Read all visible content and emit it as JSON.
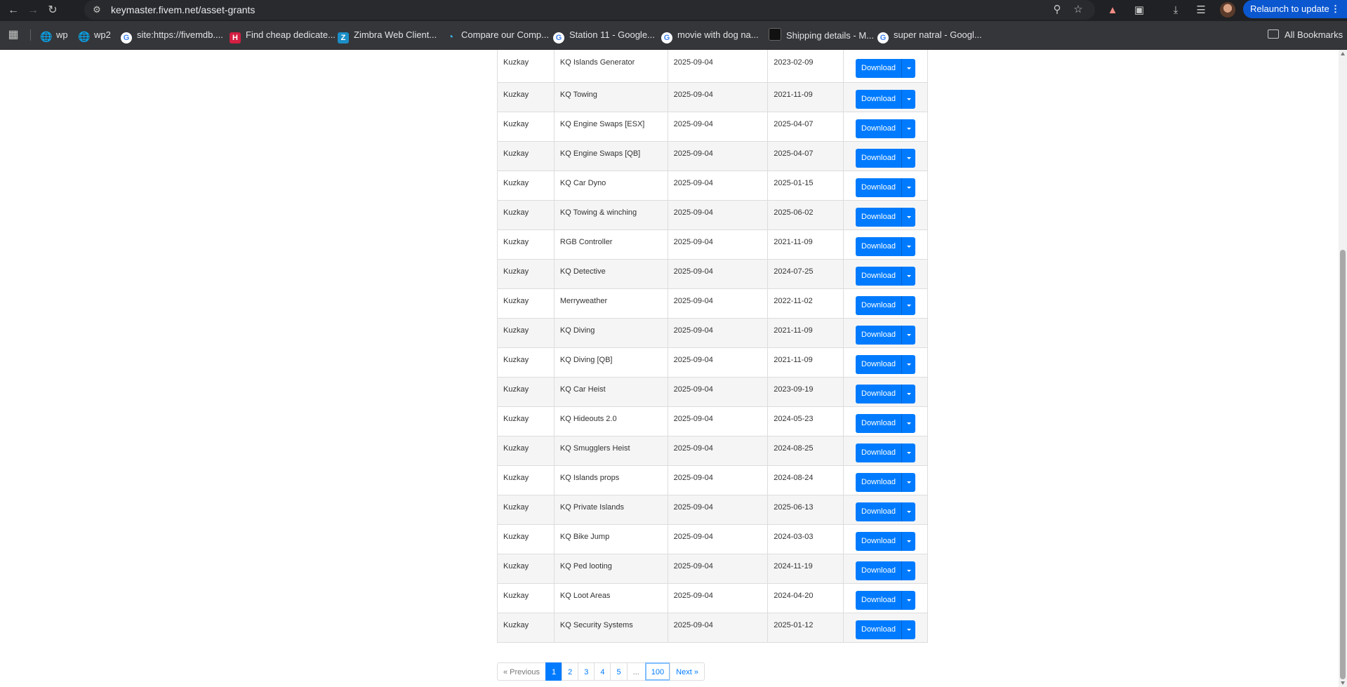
{
  "browser": {
    "url": "keymaster.fivem.net/asset-grants",
    "relaunch_label": "Relaunch to update",
    "bookmarks": [
      {
        "label": "wp",
        "icon": "globe-icon"
      },
      {
        "label": "wp2",
        "icon": "globe-icon"
      },
      {
        "label": "site:https://fivemdb....",
        "icon": "google-icon"
      },
      {
        "label": "Find cheap dedicate...",
        "icon": "hetzner-icon"
      },
      {
        "label": "Zimbra Web Client...",
        "icon": "zimbra-icon"
      },
      {
        "label": "Compare our Comp...",
        "icon": "compare-icon"
      },
      {
        "label": "Station 11 - Google...",
        "icon": "google-icon"
      },
      {
        "label": "movie with dog na...",
        "icon": "google-icon"
      },
      {
        "label": "Shipping details - M...",
        "icon": "shipping-icon"
      },
      {
        "label": "super natral - Googl...",
        "icon": "google-icon"
      }
    ],
    "all_bookmarks_label": "All Bookmarks"
  },
  "table": {
    "action_label": "Download",
    "rows": [
      {
        "owner": "Kuzkay",
        "name": "KQ Islands Generator",
        "granted": "2025-09-04",
        "created": "2023-02-09"
      },
      {
        "owner": "Kuzkay",
        "name": "KQ Towing",
        "granted": "2025-09-04",
        "created": "2021-11-09"
      },
      {
        "owner": "Kuzkay",
        "name": "KQ Engine Swaps [ESX]",
        "granted": "2025-09-04",
        "created": "2025-04-07"
      },
      {
        "owner": "Kuzkay",
        "name": "KQ Engine Swaps [QB]",
        "granted": "2025-09-04",
        "created": "2025-04-07"
      },
      {
        "owner": "Kuzkay",
        "name": "KQ Car Dyno",
        "granted": "2025-09-04",
        "created": "2025-01-15"
      },
      {
        "owner": "Kuzkay",
        "name": "KQ Towing & winching",
        "granted": "2025-09-04",
        "created": "2025-06-02"
      },
      {
        "owner": "Kuzkay",
        "name": "RGB Controller",
        "granted": "2025-09-04",
        "created": "2021-11-09"
      },
      {
        "owner": "Kuzkay",
        "name": "KQ Detective",
        "granted": "2025-09-04",
        "created": "2024-07-25"
      },
      {
        "owner": "Kuzkay",
        "name": "Merryweather",
        "granted": "2025-09-04",
        "created": "2022-11-02"
      },
      {
        "owner": "Kuzkay",
        "name": "KQ Diving",
        "granted": "2025-09-04",
        "created": "2021-11-09"
      },
      {
        "owner": "Kuzkay",
        "name": "KQ Diving [QB]",
        "granted": "2025-09-04",
        "created": "2021-11-09"
      },
      {
        "owner": "Kuzkay",
        "name": "KQ Car Heist",
        "granted": "2025-09-04",
        "created": "2023-09-19"
      },
      {
        "owner": "Kuzkay",
        "name": "KQ Hideouts 2.0",
        "granted": "2025-09-04",
        "created": "2024-05-23"
      },
      {
        "owner": "Kuzkay",
        "name": "KQ Smugglers Heist",
        "granted": "2025-09-04",
        "created": "2024-08-25"
      },
      {
        "owner": "Kuzkay",
        "name": "KQ Islands props",
        "granted": "2025-09-04",
        "created": "2024-08-24"
      },
      {
        "owner": "Kuzkay",
        "name": "KQ Private Islands",
        "granted": "2025-09-04",
        "created": "2025-06-13"
      },
      {
        "owner": "Kuzkay",
        "name": "KQ Bike Jump",
        "granted": "2025-09-04",
        "created": "2024-03-03"
      },
      {
        "owner": "Kuzkay",
        "name": "KQ Ped looting",
        "granted": "2025-09-04",
        "created": "2024-11-19"
      },
      {
        "owner": "Kuzkay",
        "name": "KQ Loot Areas",
        "granted": "2025-09-04",
        "created": "2024-04-20"
      },
      {
        "owner": "Kuzkay",
        "name": "KQ Security Systems",
        "granted": "2025-09-04",
        "created": "2025-01-12"
      }
    ]
  },
  "pagination": {
    "previous": "« Previous",
    "pages": [
      "1",
      "2",
      "3",
      "4",
      "5"
    ],
    "ellipsis": "...",
    "last_page": "100",
    "next": "Next »",
    "current": "1"
  },
  "colors": {
    "primary": "#007bff",
    "chrome_dark": "#202124",
    "relaunch": "#0b57d0"
  }
}
